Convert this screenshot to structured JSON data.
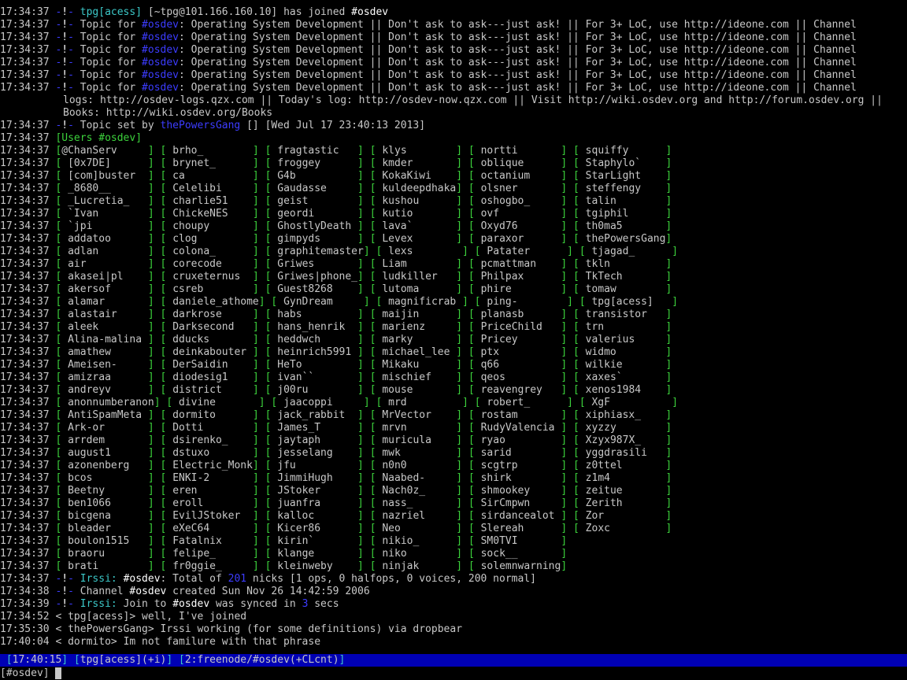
{
  "join": {
    "ts": "17:34:37",
    "nick": "tpg[acess]",
    "host": "[~tpg@101.166.160.10]",
    "text": " has joined ",
    "channel": "#osdev"
  },
  "topic": {
    "ts": "17:34:37",
    "prefix": "Topic for ",
    "channel": "#osdev",
    "text": ": Operating System Development || Don't ask to ask---just ask! || For 3+ LoC, use http://ideone.com || Channel",
    "cont1": "logs: http://osdev-logs.qzx.com || Today's log: http://osdev-now.qzx.com || Visit http://wiki.osdev.org and http://forum.osdev.org ||",
    "cont2": "Books: http://wiki.osdev.org/Books"
  },
  "topic_set": {
    "ts": "17:34:37",
    "prefix": "Topic set by ",
    "nick": "thePowersGang",
    "text": " [] [Wed Jul 17 23:40:13 2013]"
  },
  "users_header": {
    "ts": "17:34:37",
    "text": "[Users #osdev]"
  },
  "users": {
    "ts": "17:34:37",
    "rows": [
      [
        "@ChanServ",
        "brho_",
        "fragtastic",
        "klys",
        "nortti",
        "squiffy"
      ],
      [
        "[0x7DE]",
        "brynet_",
        "froggey",
        "kmder",
        "oblique",
        "Staphylo`"
      ],
      [
        "[com]buster",
        "ca",
        "G4b",
        "KokaKiwi",
        "octanium",
        "StarLight"
      ],
      [
        "_8680__",
        "Celelibi",
        "Gaudasse",
        "kuldeepdhaka",
        "olsner",
        "steffengy"
      ],
      [
        "_Lucretia_",
        "charlie51",
        "geist",
        "kushou",
        "oshogbo_",
        "talin"
      ],
      [
        "`Ivan",
        "ChickeNES",
        "geordi",
        "kutio",
        "ovf",
        "tgiphil"
      ],
      [
        "`jpi",
        "choupy",
        "GhostlyDeath",
        "lava`",
        "Oxyd76",
        "th0ma5"
      ],
      [
        "addatoo",
        "clog",
        "gimpyds",
        "Levex",
        "paraxor",
        "thePowersGang"
      ],
      [
        "adlan",
        "colona_",
        "graphitemaster",
        "lexs",
        "Patater",
        "tjagad_"
      ],
      [
        "air",
        "corecode",
        "Griwes",
        "Liam",
        "pcmattman",
        "tkln"
      ],
      [
        "akasei|pl",
        "cruxeternus",
        "Griwes|phone_",
        "ludkiller",
        "Philpax",
        "TkTech"
      ],
      [
        "akersof",
        "csreb",
        "Guest8268",
        "lutoma",
        "phire",
        "tomaw"
      ],
      [
        "alamar",
        "daniele_athome",
        "GynDream",
        "magnificrab",
        "ping-",
        "tpg[acess]"
      ],
      [
        "alastair",
        "darkrose",
        "habs",
        "maijin",
        "planasb",
        "transistor"
      ],
      [
        "aleek",
        "Darksecond",
        "hans_henrik",
        "marienz",
        "PriceChild",
        "trn"
      ],
      [
        "Alina-malina",
        "dducks",
        "heddwch",
        "marky",
        "Pricey",
        "valerius"
      ],
      [
        "amathew",
        "deinkabouter",
        "heinrich5991",
        "michael_lee",
        "ptx",
        "widmo"
      ],
      [
        "Ameisen-",
        "DerSaidin",
        "HeTo",
        "Mikaku",
        "q66",
        "wilkie"
      ],
      [
        "amizraa",
        "diodesig1",
        "ivan``",
        "mischief",
        "qeos",
        "xaxes`"
      ],
      [
        "andreyv",
        "district",
        "j00ru",
        "mouse",
        "reavengrey",
        "xenos1984"
      ],
      [
        "anonnumberanon",
        "divine",
        "jaacoppi",
        "mrd",
        "robert_",
        "XgF"
      ],
      [
        "AntiSpamMeta",
        "dormito",
        "jack_rabbit",
        "MrVector",
        "rostam",
        "xiphiasx_"
      ],
      [
        "Ark-or",
        "Dotti",
        "James_T",
        "mrvn",
        "RudyValencia",
        "xyzzy"
      ],
      [
        "arrdem",
        "dsirenko_",
        "jaytaph",
        "muricula",
        "ryao",
        "Xzyx987X_"
      ],
      [
        "august1",
        "dstuxo",
        "jesselang",
        "mwk",
        "sarid",
        "yggdrasili"
      ],
      [
        "azonenberg",
        "Electric_Monk",
        "jfu",
        "n0n0",
        "scgtrp",
        "z0ttel"
      ],
      [
        "bcos",
        "ENKI-2",
        "JimmiHugh",
        "Naabed-",
        "shirk",
        "z1m4"
      ],
      [
        "Beetny",
        "eren",
        "JStoker",
        "Nach0z_",
        "shmookey",
        "zeitue"
      ],
      [
        "ben1066",
        "eroll",
        "juanfra",
        "nass_",
        "SirCmpwn",
        "Zerith"
      ],
      [
        "bicgena",
        "EvilJStoker",
        "kalloc",
        "nazriel",
        "sirdancealot",
        "Zor"
      ],
      [
        "bleader",
        "eXeC64",
        "Kicer86",
        "Neo",
        "Slereah",
        "Zoxc"
      ],
      [
        "boulon1515",
        "Fatalnix",
        "kirin`",
        "nikio_",
        "SM0TVI",
        ""
      ],
      [
        "braoru",
        "felipe_",
        "klange",
        "niko",
        "sock__",
        ""
      ],
      [
        "brati",
        "fr0ggie_",
        "kleinweby",
        "ninjak",
        "solemnwarning",
        ""
      ]
    ]
  },
  "total": {
    "ts": "17:34:37",
    "irssi": "Irssi: ",
    "channel": "#osdev",
    "text1": ": Total of ",
    "count": "201",
    "text2": " nicks [1 ops, 0 halfops, 0 voices, 200 normal]"
  },
  "created": {
    "ts": "17:34:38",
    "prefix": "Channel ",
    "channel": "#osdev",
    "text": " created Sun Nov 26 14:42:59 2006"
  },
  "synced": {
    "ts": "17:34:39",
    "irssi": "Irssi: ",
    "prefix": "Join to ",
    "channel": "#osdev",
    "text1": " was synced in ",
    "secs": "3",
    "text2": " secs"
  },
  "messages": [
    {
      "ts": "17:34:52",
      "nick": "tpg[acess]",
      "text": "well, I've joined"
    },
    {
      "ts": "17:35:30",
      "nick": "thePowersGang",
      "text": "Irssi working (for some definitions) via dropbear"
    },
    {
      "ts": "17:40:04",
      "nick": "dormito",
      "text": "Im not familure with that phrase"
    }
  ],
  "statusbar": {
    "time": "17:40:15",
    "nick": "tpg[acess]",
    "mode": "+i",
    "window": "2:freenode/#osdev",
    "chanmode": "+CLcnt"
  },
  "prompt": {
    "label": "[#osdev]"
  },
  "colors": {
    "background": "#000000",
    "text": "#c8c8c8",
    "accent_cyan": "#3cc8c8",
    "accent_blue": "#3c3cff",
    "users_green": "#3cd23c",
    "statusbar_bg": "#0000b4"
  }
}
